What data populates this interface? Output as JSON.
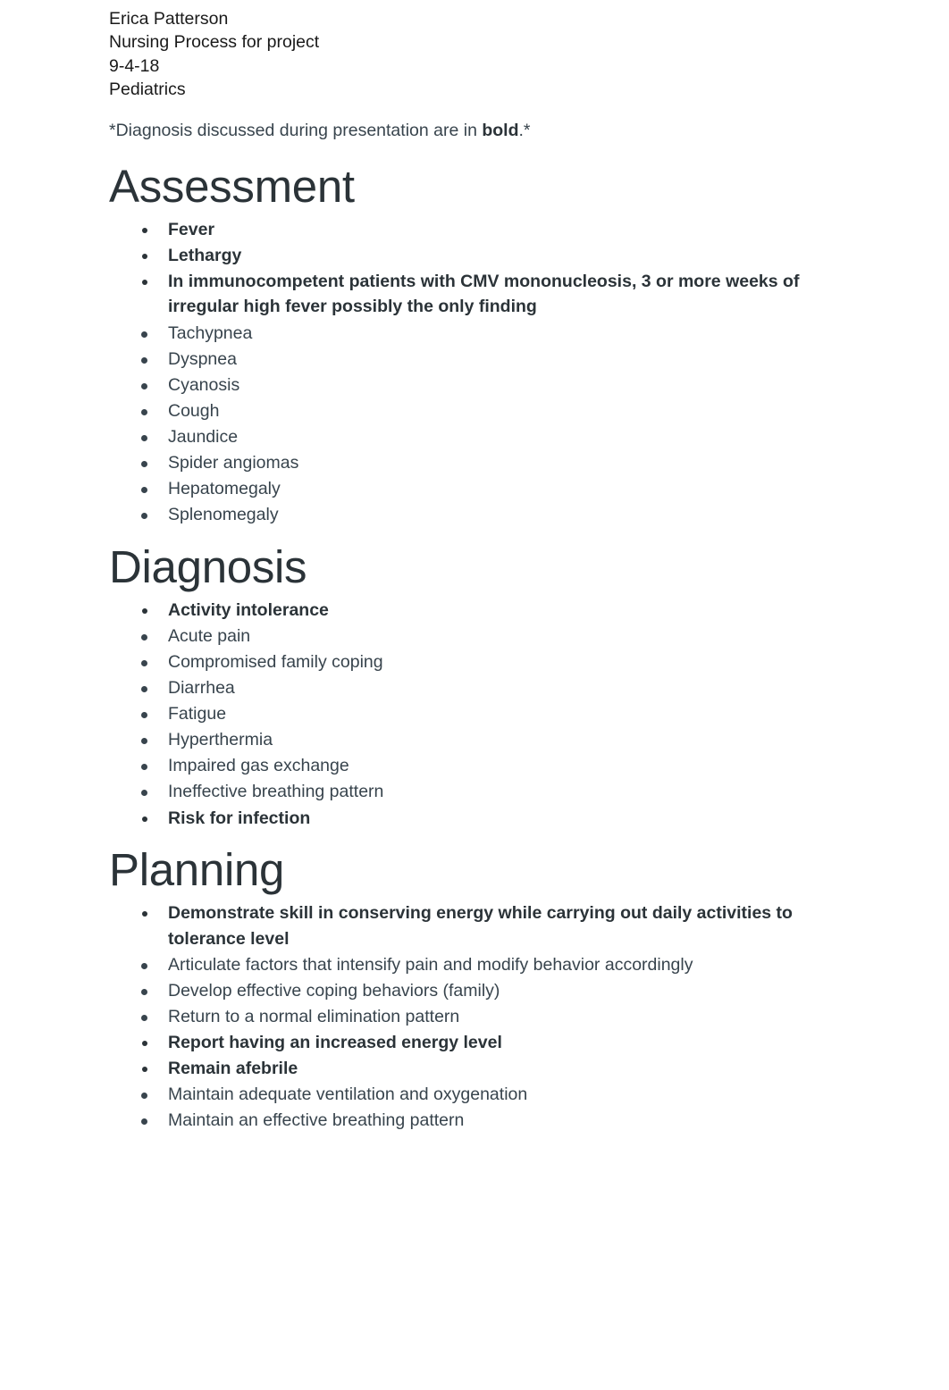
{
  "header": {
    "lines": [
      "Erica Patterson",
      "Nursing Process for project",
      "9-4-18",
      "Pediatrics"
    ]
  },
  "note": {
    "prefix": "*Diagnosis discussed during presentation are in ",
    "emphasis": "bold",
    "suffix": ".*"
  },
  "sections": [
    {
      "title": "Assessment",
      "items": [
        {
          "text": "Fever",
          "bold": true
        },
        {
          "text": "Lethargy",
          "bold": true
        },
        {
          "text": "In immunocompetent patients with CMV mononucleosis, 3 or more weeks of irregular high fever possibly the only finding",
          "bold": true
        },
        {
          "text": "Tachypnea",
          "bold": false
        },
        {
          "text": "Dyspnea",
          "bold": false
        },
        {
          "text": "Cyanosis",
          "bold": false
        },
        {
          "text": "Cough",
          "bold": false
        },
        {
          "text": "Jaundice",
          "bold": false
        },
        {
          "text": "Spider angiomas",
          "bold": false
        },
        {
          "text": "Hepatomegaly",
          "bold": false
        },
        {
          "text": "Splenomegaly",
          "bold": false
        }
      ]
    },
    {
      "title": "Diagnosis",
      "items": [
        {
          "text": "Activity intolerance",
          "bold": true
        },
        {
          "text": "Acute pain",
          "bold": false
        },
        {
          "text": "Compromised family coping",
          "bold": false
        },
        {
          "text": "Diarrhea",
          "bold": false
        },
        {
          "text": "Fatigue",
          "bold": false
        },
        {
          "text": "Hyperthermia",
          "bold": false
        },
        {
          "text": "Impaired gas exchange",
          "bold": false
        },
        {
          "text": "Ineffective breathing pattern",
          "bold": false
        },
        {
          "text": "Risk for infection",
          "bold": true
        }
      ]
    },
    {
      "title": "Planning",
      "items": [
        {
          "text": "Demonstrate skill in conserving energy while carrying out daily activities to tolerance level",
          "bold": true
        },
        {
          "text": "Articulate factors that intensify pain and modify behavior accordingly",
          "bold": false
        },
        {
          "text": "Develop effective coping behaviors (family)",
          "bold": false
        },
        {
          "text": "Return to a normal elimination pattern",
          "bold": false
        },
        {
          "text": "Report having an increased energy level",
          "bold": true
        },
        {
          "text": "Remain afebrile",
          "bold": true
        },
        {
          "text": "Maintain adequate ventilation and oxygenation",
          "bold": false
        },
        {
          "text": "Maintain an effective breathing pattern",
          "bold": false
        }
      ]
    }
  ],
  "colors": {
    "page_background": "#ffffff",
    "header_text": "#1a1a1a",
    "body_text": "#38444d",
    "heading_text": "#2b3338"
  }
}
